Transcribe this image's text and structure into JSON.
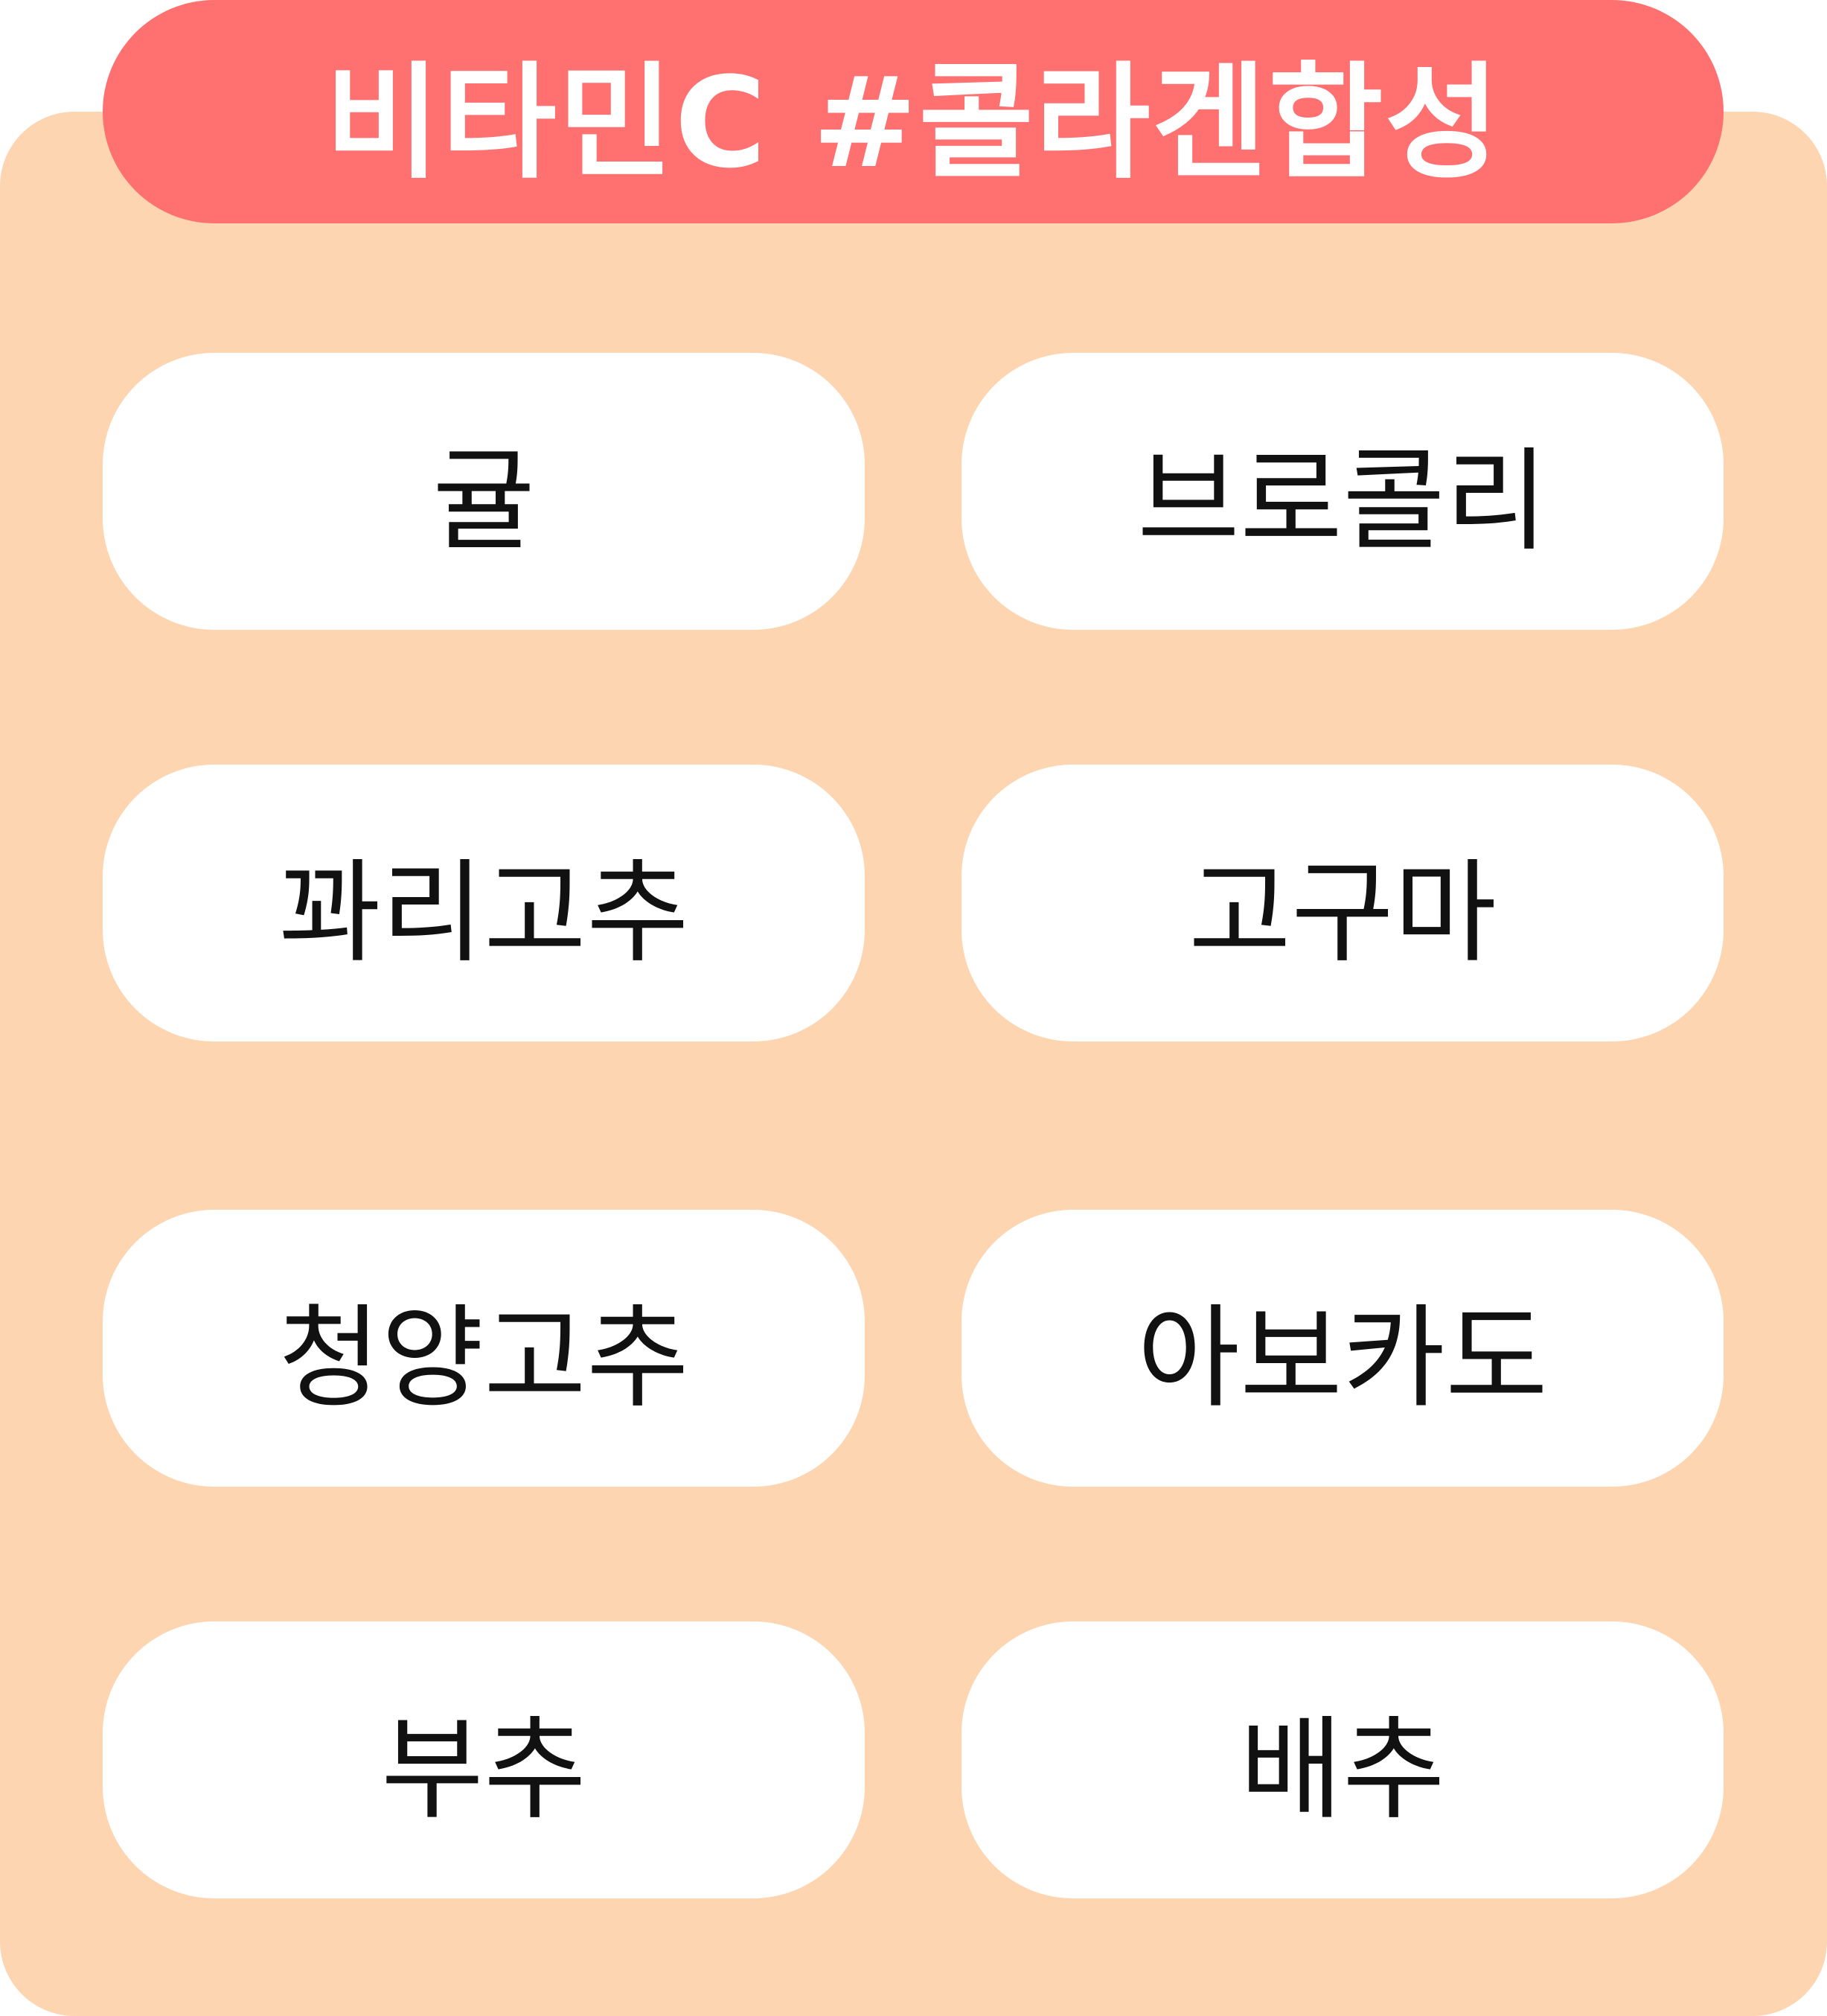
{
  "header": {
    "title": "비타민C",
    "hashtag": "#콜라겐합성"
  },
  "foods": [
    "귤",
    "브로콜리",
    "꽈리고추",
    "고구마",
    "청양고추",
    "아보카도",
    "부추",
    "배추"
  ],
  "colors": {
    "card_background": "#FDD5B1",
    "header_background": "#FF7070",
    "header_text": "#FFFFFF",
    "pill_background": "#FFFFFF",
    "pill_text": "#111111"
  }
}
